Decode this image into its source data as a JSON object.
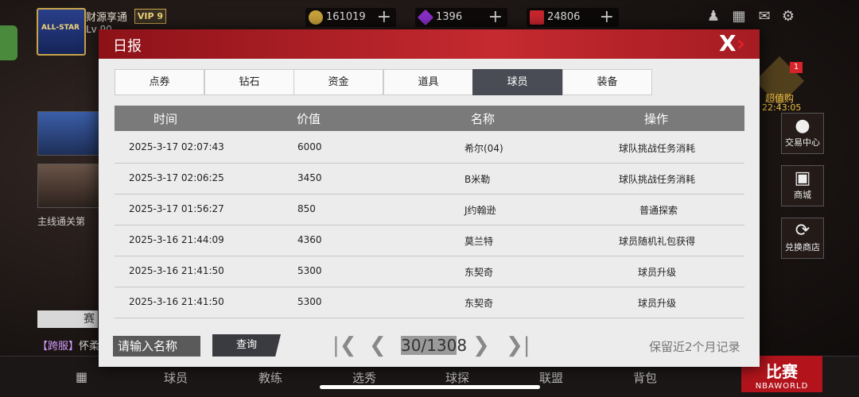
{
  "profile": {
    "name": "财源享通",
    "vip": "VIP 9",
    "level": "Lv 90",
    "badge": "ALL-STAR"
  },
  "resources": [
    {
      "icon": "coin-icon",
      "value": "161019"
    },
    {
      "icon": "diamond-icon",
      "value": "1396"
    },
    {
      "icon": "ticket-icon",
      "value": "24806"
    }
  ],
  "side_right": {
    "deal_label": "超值购",
    "deal_timer": "22:43:05",
    "deal_badge": "1",
    "trade": "交易中心",
    "shop": "商城",
    "exchange": "兑换商店"
  },
  "side_left": {
    "mainline": "主线通关第",
    "event": "赛",
    "server": "【跨服】",
    "server_text": "怀柔"
  },
  "bottom_nav": [
    "球员",
    "教练",
    "选秀",
    "球探",
    "联盟",
    "背包"
  ],
  "match_button": {
    "label": "比赛",
    "sub": "NBAWORLD"
  },
  "dialog": {
    "title": "日报",
    "tabs": [
      "点券",
      "钻石",
      "资金",
      "道具",
      "球员",
      "装备"
    ],
    "active_tab": 4,
    "columns": [
      "时间",
      "价值",
      "名称",
      "操作"
    ],
    "rows": [
      {
        "time": "2025-3-17 02:07:43",
        "value": "6000",
        "name": "希尔(04)",
        "action": "球队挑战任务消耗"
      },
      {
        "time": "2025-3-17 02:06:25",
        "value": "3450",
        "name": "B米勒",
        "action": "球队挑战任务消耗"
      },
      {
        "time": "2025-3-17 01:56:27",
        "value": "850",
        "name": "J约翰逊",
        "action": "普通探索"
      },
      {
        "time": "2025-3-16 21:44:09",
        "value": "4360",
        "name": "莫兰特",
        "action": "球员随机礼包获得"
      },
      {
        "time": "2025-3-16 21:41:50",
        "value": "5300",
        "name": "东契奇",
        "action": "球员升级"
      },
      {
        "time": "2025-3-16 21:41:50",
        "value": "5300",
        "name": "东契奇",
        "action": "球员升级"
      }
    ],
    "search_placeholder": "请输入名称",
    "query_label": "查询",
    "page": "30/1308",
    "note": "保留近2个月记录"
  }
}
